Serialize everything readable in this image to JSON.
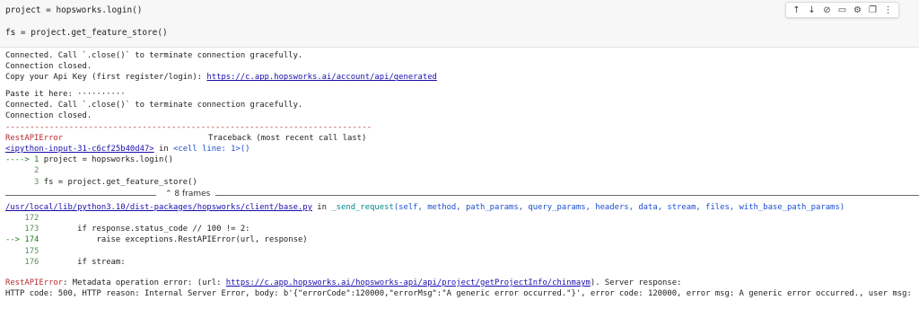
{
  "cell": {
    "code_line1": "project = hopsworks.login()",
    "code_line2": "fs = project.get_feature_store()"
  },
  "toolbar": {
    "up": "↑",
    "down": "↓",
    "link": "⊘",
    "comment": "▭",
    "settings": "⚙",
    "copy": "❐",
    "more": "⋮"
  },
  "output": {
    "l1": "Connected. Call `.close()` to terminate connection gracefully.",
    "l2": "Connection closed.",
    "l3_prefix": "Copy your Api Key (first register/login): ",
    "l3_link": "https://c.app.hopsworks.ai/account/api/generated",
    "l4": "Paste it here: ··········",
    "l5": "Connected. Call `.close()` to terminate connection gracefully.",
    "l6": "Connection closed.",
    "divider": "---------------------------------------------------------------------------",
    "err_name": "RestAPIError",
    "traceback_head": "Traceback (most recent call last)",
    "ipy_link": "<ipython-input-31-c6cf25b40d47>",
    "in_cell": " in ",
    "cell_line": "<cell line: 1>()",
    "arrow1": "----> 1 ",
    "tb1_code": "project = hopsworks.login()",
    "tb2_num": "      2",
    "tb3_num": "      3 ",
    "tb3_code": "fs = project.get_feature_store()",
    "frames_label": "⌃ 8 frames",
    "path_link": "/usr/local/lib/python3.10/dist-packages/hopsworks/client/base.py",
    "in2": " in ",
    "send_req": "_send_request",
    "send_args": "(self, method, path_params, query_params, headers, data, stream, files, with_base_path_params)",
    "s172": "    172",
    "s173_num": "    173",
    "s173_code": "        if response.status_code // 100 != 2:",
    "s174_num": "--> 174",
    "s174_code": "            raise exceptions.RestAPIError(url, response)",
    "s175": "    175",
    "s176_num": "    176",
    "s176_code": "        if stream:",
    "final_err": "RestAPIError",
    "final_msg": ": Metadata operation error: (url: ",
    "final_link": "https://c.app.hopsworks.ai/hopsworks-api/api/project/getProjectInfo/chinmaym",
    "final_tail": "). Server response:",
    "final_l2": "HTTP code: 500, HTTP reason: Internal Server Error, body: b'{\"errorCode\":120000,\"errorMsg\":\"A generic error occurred.\"}', error code: 120000, error msg: A generic error occurred., user msg:"
  }
}
